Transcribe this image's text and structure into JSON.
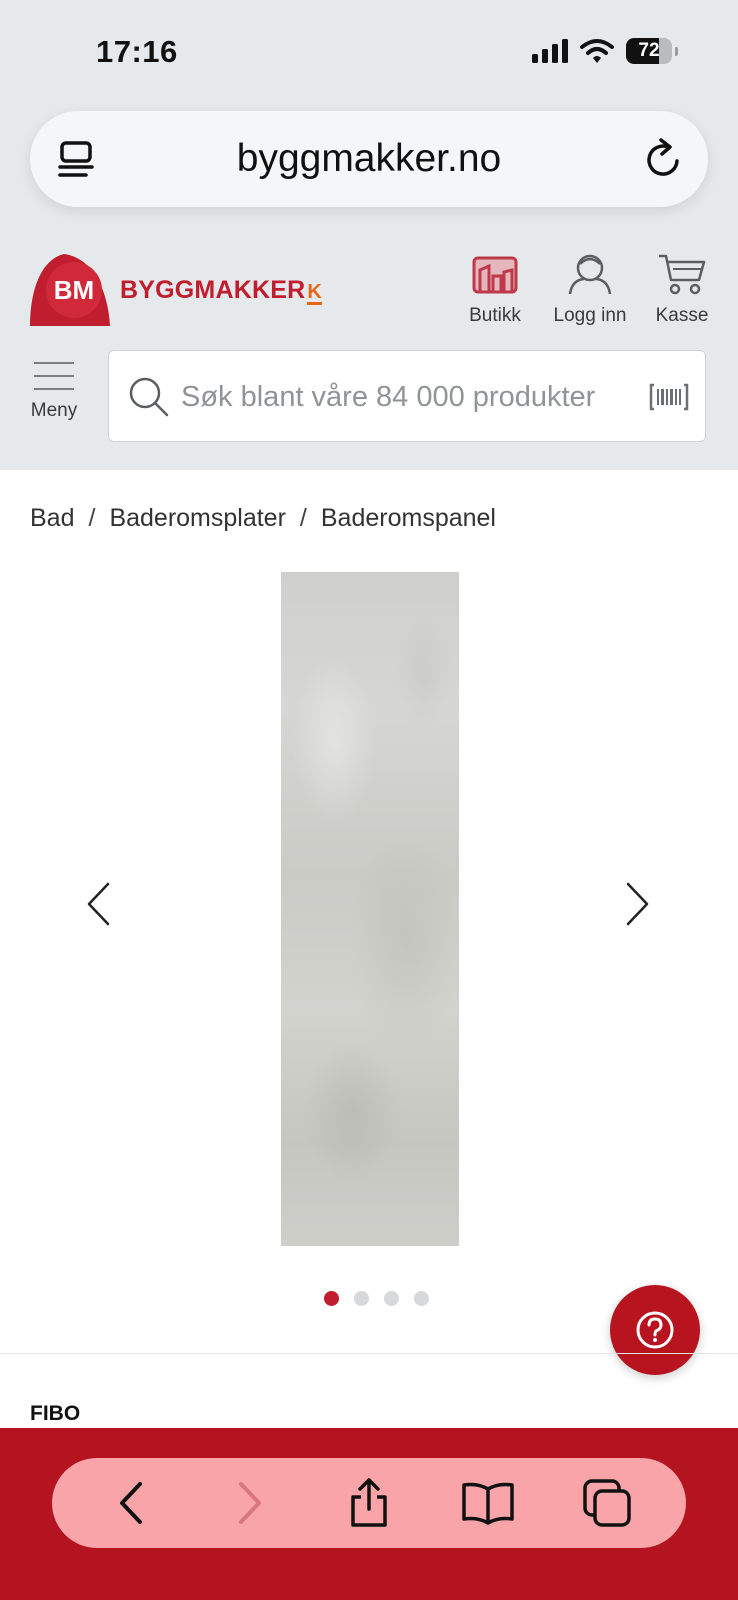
{
  "status_bar": {
    "time": "17:16",
    "battery": "72"
  },
  "browser": {
    "url": "byggmakker.no"
  },
  "header": {
    "logo_badge": "BM",
    "logo_name": "BYGGMAKKER",
    "logo_suffix": "K",
    "buttons": [
      {
        "label": "Butikk",
        "icon": "store-icon"
      },
      {
        "label": "Logg inn",
        "icon": "user-icon"
      },
      {
        "label": "Kasse",
        "icon": "cart-icon"
      }
    ],
    "menu_label": "Meny",
    "search_placeholder": "Søk blant våre 84 000 produkter"
  },
  "breadcrumb": [
    "Bad",
    "Baderomsplater",
    "Baderomspanel"
  ],
  "breadcrumb_separator": "/",
  "gallery": {
    "image_count": 4,
    "active_index": 0
  },
  "product": {
    "brand": "FIBO"
  },
  "colors": {
    "brand_red": "#c01e2e",
    "toolbar_red": "#b3141f",
    "header_bg": "#e6e9eb",
    "accent_orange": "#e8661b"
  }
}
